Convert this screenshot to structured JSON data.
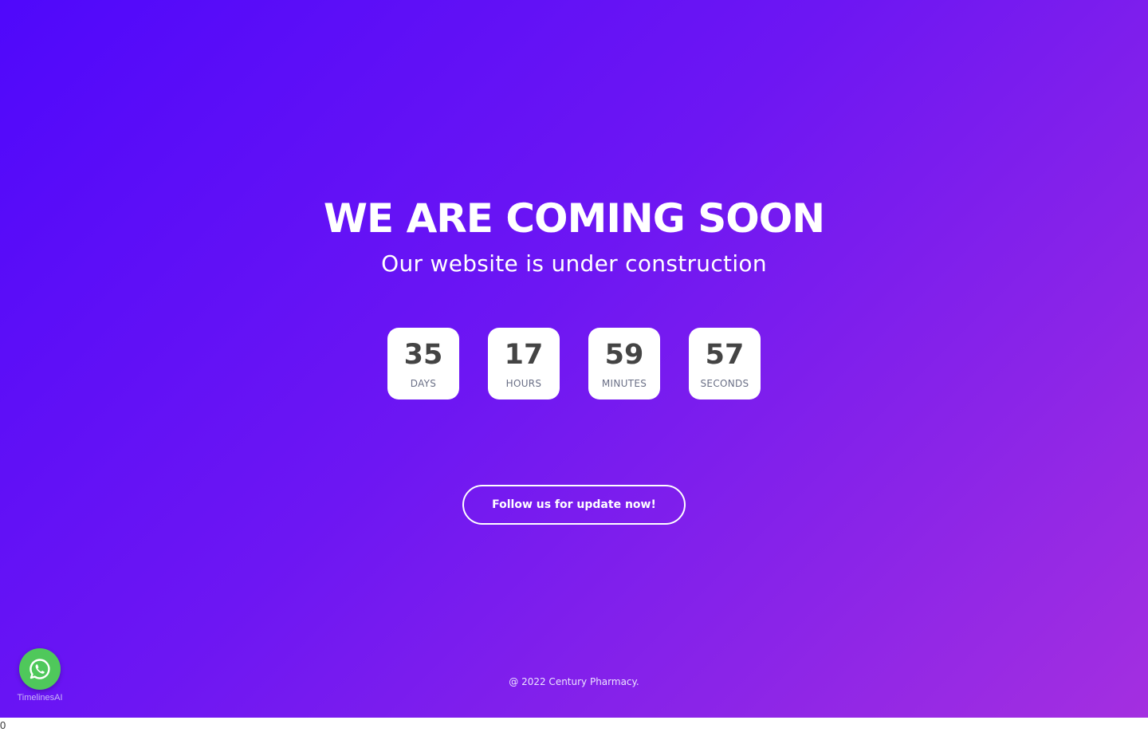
{
  "page": {
    "background_gradient": [
      "#4f08fb",
      "#a42fe0"
    ],
    "accent_color": "#ffffff"
  },
  "hero": {
    "title": "WE ARE COMING SOON",
    "subtitle": "Our website is under construction"
  },
  "countdown": [
    {
      "value": "35",
      "label": "DAYS"
    },
    {
      "value": "17",
      "label": "HOURS"
    },
    {
      "value": "59",
      "label": "MINUTES"
    },
    {
      "value": "57",
      "label": "SECONDS"
    }
  ],
  "follow_button": {
    "label": "Follow us for update now!"
  },
  "footer": {
    "copyright": "@ 2022 Century Pharmacy."
  },
  "whatsapp_widget": {
    "icon": "whatsapp-icon",
    "label": "TimelinesAI",
    "color": "#4fc85b"
  },
  "stray_text": "0"
}
